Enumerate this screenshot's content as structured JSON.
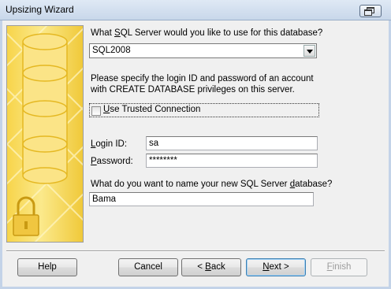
{
  "window": {
    "title": "Upsizing  Wizard",
    "control_icon": "restore-icon"
  },
  "panel": {
    "decor_icon": "database-lock-icon"
  },
  "server": {
    "question_pre": "What ",
    "question_key": "S",
    "question_post": "QL Server would you like to use for this database?",
    "value": "SQL2008",
    "dropdown_icon": "chevron-down-icon"
  },
  "instructions": {
    "line1": "Please specify the login ID and password of an account",
    "line2": "with CREATE DATABASE privileges on this server."
  },
  "trusted": {
    "key": "U",
    "label_rest": "se Trusted Connection",
    "checked": false
  },
  "login": {
    "label_key": "L",
    "label_rest": "ogin ID:",
    "value": "sa"
  },
  "password": {
    "label_key": "P",
    "label_rest": "assword:",
    "value": "********"
  },
  "dbname": {
    "question_pre": "What do you want to name your new SQL Server ",
    "question_key": "d",
    "question_post": "atabase?",
    "value": "Bama"
  },
  "buttons": {
    "help": "Help",
    "cancel": "Cancel",
    "back_pre": "< ",
    "back_key": "B",
    "back_post": "ack",
    "next_pre": "",
    "next_key": "N",
    "next_post": "ext >",
    "finish_pre": "",
    "finish_key": "F",
    "finish_post": "inish"
  }
}
